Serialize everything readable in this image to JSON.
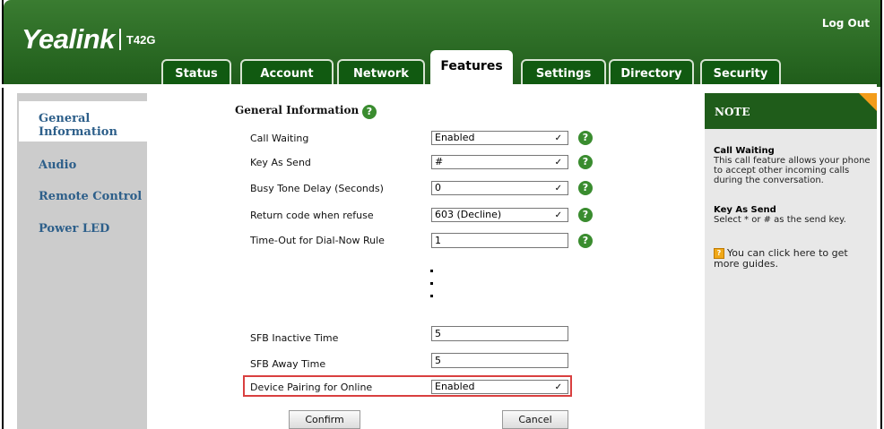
{
  "brand": {
    "name": "Yealink",
    "model": "T42G"
  },
  "header": {
    "logout": "Log Out"
  },
  "tabs": [
    "Status",
    "Account",
    "Network",
    "Features",
    "Settings",
    "Directory",
    "Security"
  ],
  "active_tab": "Features",
  "sidebar": {
    "items": [
      {
        "label": "General Information",
        "line1": "General",
        "line2": "Information",
        "active": true
      },
      {
        "label": "Audio"
      },
      {
        "label": "Remote Control"
      },
      {
        "label": "Power LED"
      }
    ]
  },
  "main": {
    "section_title": "General Information",
    "fields": [
      {
        "label": "Call Waiting",
        "value": "Enabled",
        "type": "select"
      },
      {
        "label": "Key As Send",
        "value": "#",
        "type": "select"
      },
      {
        "label": "Busy Tone Delay (Seconds)",
        "value": "0",
        "type": "select"
      },
      {
        "label": "Return code when refuse",
        "value": "603 (Decline)",
        "type": "select"
      },
      {
        "label": "Time-Out for Dial-Now Rule",
        "value": "1",
        "type": "input"
      },
      {
        "label": "SFB Inactive Time",
        "value": "5",
        "type": "input"
      },
      {
        "label": "SFB Away Time",
        "value": "5",
        "type": "input"
      },
      {
        "label": "Device Pairing for Online",
        "value": "Enabled",
        "type": "select"
      }
    ],
    "confirm": "Confirm",
    "cancel": "Cancel"
  },
  "note": {
    "title": "NOTE",
    "sections": [
      {
        "heading": "Call Waiting",
        "text": "This call feature allows your phone to accept other incoming calls during the conversation."
      },
      {
        "heading": "Key As Send",
        "text": "Select * or # as the send key."
      }
    ],
    "guide": "You can click here to get more guides."
  },
  "colors": {
    "header_green": "#2b6e25",
    "link_blue": "#2d5f8a",
    "help_green": "#3a8c2f",
    "highlight_red": "#d94040",
    "note_corner": "#f39c1a"
  }
}
